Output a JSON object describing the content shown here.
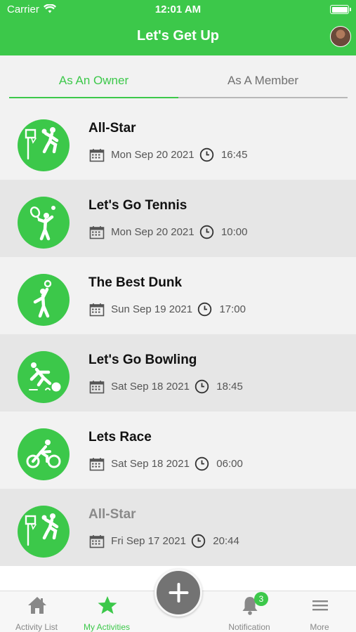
{
  "status_bar": {
    "carrier": "Carrier",
    "time": "12:01 AM"
  },
  "header": {
    "title": "Let's Get Up"
  },
  "tabs": [
    {
      "label": "As An Owner",
      "selected": true
    },
    {
      "label": "As A Member",
      "selected": false
    }
  ],
  "activities": [
    {
      "name": "All-Star",
      "date": "Mon Sep 20 2021",
      "time": "16:45",
      "icon": "basketball-icon"
    },
    {
      "name": "Let's Go Tennis",
      "date": "Mon Sep 20 2021",
      "time": "10:00",
      "icon": "tennis-icon"
    },
    {
      "name": "The Best Dunk",
      "date": "Sun Sep 19 2021",
      "time": "17:00",
      "icon": "volleyball-icon"
    },
    {
      "name": "Let's Go Bowling",
      "date": "Sat Sep 18 2021",
      "time": "18:45",
      "icon": "bowling-icon"
    },
    {
      "name": "Lets Race",
      "date": "Sat Sep 18 2021",
      "time": "06:00",
      "icon": "cycling-icon"
    },
    {
      "name": "All-Star",
      "date": "Fri Sep 17 2021",
      "time": "20:44",
      "icon": "basketball-icon"
    }
  ],
  "tab_bar": {
    "items": [
      {
        "label": "Activity List",
        "icon": "home-icon",
        "active": false
      },
      {
        "label": "My Activities",
        "icon": "star-icon",
        "active": true
      },
      {
        "label": "Notification",
        "icon": "bell-icon",
        "active": false,
        "badge": "3"
      },
      {
        "label": "More",
        "icon": "menu-icon",
        "active": false
      }
    ]
  },
  "colors": {
    "accent": "#3cc84a",
    "fab": "#737373",
    "row_light": "#f2f2f2",
    "row_dark": "#e6e6e6"
  }
}
